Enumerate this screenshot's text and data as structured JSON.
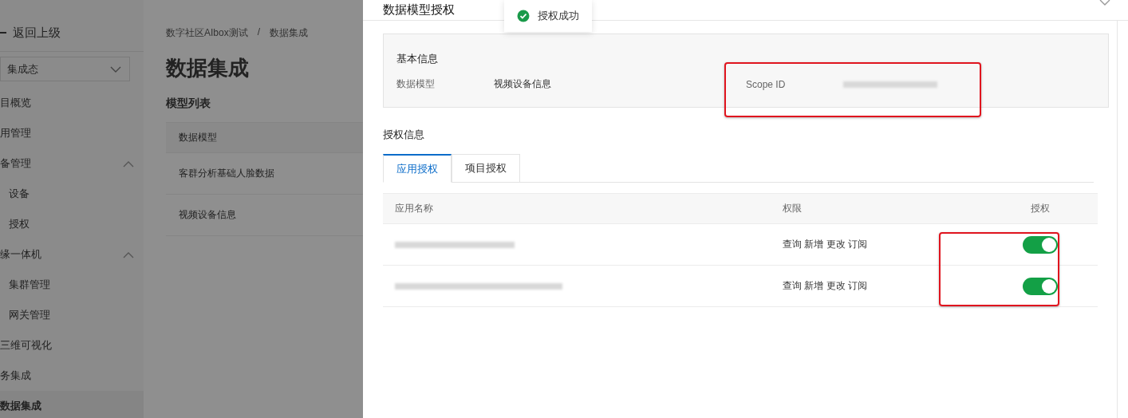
{
  "sidebar": {
    "back": "返回上级",
    "select": "集成态",
    "items": [
      {
        "label": "目概览",
        "selected": false
      },
      {
        "label": "用管理",
        "selected": false
      },
      {
        "label": "备管理",
        "selected": false,
        "expanded": true,
        "children": [
          {
            "label": "设备",
            "selected": false
          },
          {
            "label": "授权",
            "selected": false
          }
        ]
      },
      {
        "label": "缘一体机",
        "selected": false,
        "expanded": true,
        "children": [
          {
            "label": "集群管理",
            "selected": false
          },
          {
            "label": "网关管理",
            "selected": false
          }
        ]
      },
      {
        "label": "三维可视化",
        "selected": false
      },
      {
        "label": "务集成",
        "selected": false
      },
      {
        "label": "数据集成",
        "selected": true
      }
    ]
  },
  "main": {
    "breadcrumb": [
      "数字社区AIbox测试",
      "数据集成"
    ],
    "breadcrumb_separator": "/",
    "title": "数据集成",
    "section": "模型列表",
    "table": {
      "columns": [
        "数据模型"
      ],
      "rows": [
        "客群分析基础人脸数据",
        "视频设备信息"
      ]
    }
  },
  "drawer": {
    "title": "数据模型授权",
    "toast": "授权成功",
    "basic": {
      "heading": "基本信息",
      "fields": [
        {
          "label": "数据模型",
          "value": "视频设备信息",
          "blurred": false
        },
        {
          "label": "Scope ID",
          "blurred": true
        }
      ]
    },
    "auth_heading": "授权信息",
    "tabs": [
      {
        "label": "应用授权",
        "selected": true
      },
      {
        "label": "项目授权",
        "selected": false
      }
    ],
    "table": {
      "columns": [
        "应用名称",
        "权限",
        "授权"
      ],
      "rows": [
        {
          "name_blurred": true,
          "permissions": "查询 新增 更改 订阅",
          "on": true
        },
        {
          "name_blurred": true,
          "permissions": "查询 新增 更改 订阅",
          "on": true
        }
      ]
    }
  }
}
